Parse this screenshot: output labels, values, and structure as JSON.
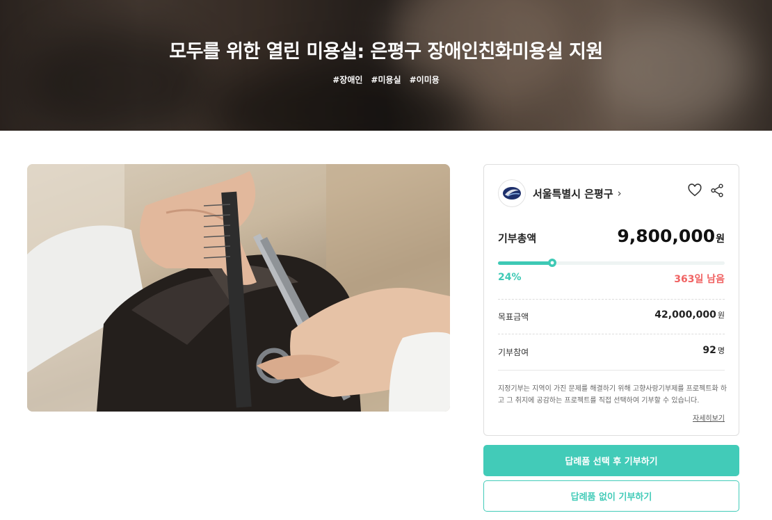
{
  "hero": {
    "title": "모두를 위한 열린 미용실: 은평구 장애인친화미용실 지원",
    "tags": [
      "#장애인",
      "#미용실",
      "#이미용"
    ]
  },
  "photo": {
    "icon": "haircut-photo"
  },
  "organization": {
    "name": "서울특별시 은평구",
    "chevron": "›",
    "logo_icon": "district-logo-icon"
  },
  "actions": {
    "like_icon": "heart-icon",
    "share_icon": "share-icon"
  },
  "donation": {
    "total_label": "기부총액",
    "total_amount": "9,800,000",
    "total_unit": "원",
    "progress_percent": 24,
    "progress_label": "24%",
    "remaining": "363일 남음",
    "goal_label": "목표금액",
    "goal_amount": "42,000,000",
    "goal_unit": "원",
    "participants_label": "기부참여",
    "participants_count": "92",
    "participants_unit": "명"
  },
  "notice": {
    "text": "지정기부는 지역이 가진 문제를 해결하기 위해 고향사랑기부제를 프로젝트화 하고 그 취지에 공감하는 프로젝트를 직접 선택하여 기부할 수 있습니다.",
    "more_link": "자세히보기"
  },
  "buttons": {
    "with_gift": "답례품 선택 후 기부하기",
    "without_gift": "답례품 없이 기부하기"
  },
  "colors": {
    "accent": "#42cbb8",
    "danger": "#f06262"
  }
}
